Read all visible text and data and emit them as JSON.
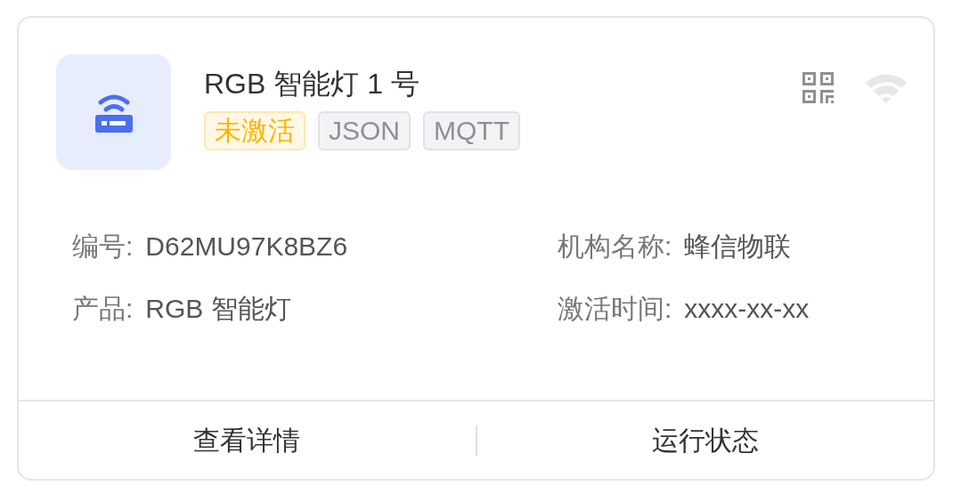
{
  "device": {
    "title": "RGB 智能灯 1 号",
    "online": false,
    "tags": [
      {
        "text": "未激活",
        "kind": "status"
      },
      {
        "text": "JSON",
        "kind": "protocol"
      },
      {
        "text": "MQTT",
        "kind": "protocol"
      }
    ]
  },
  "info": [
    {
      "label": "编号:",
      "value": "D62MU97K8BZ6"
    },
    {
      "label": "机构名称:",
      "value": "蜂信物联"
    },
    {
      "label": "产品:",
      "value": "RGB 智能灯"
    },
    {
      "label": "激活时间:",
      "value": "xxxx-xx-xx"
    }
  ],
  "actions": [
    "查看详情",
    "运行状态"
  ]
}
